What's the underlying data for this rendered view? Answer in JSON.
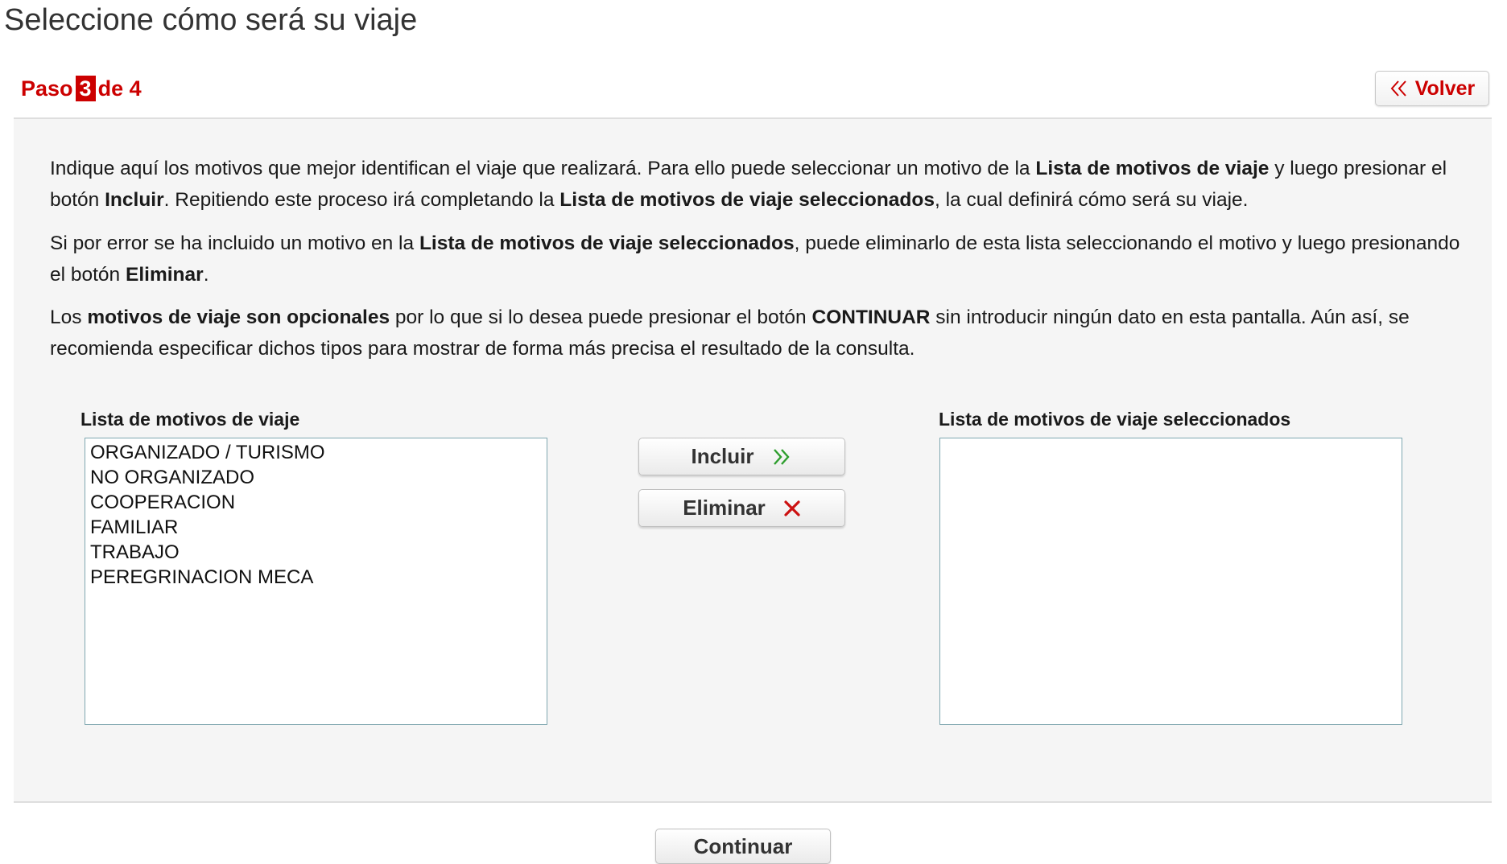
{
  "page": {
    "title": "Seleccione cómo será su viaje"
  },
  "step": {
    "word": "Paso",
    "current": "3",
    "of_text": "de 4"
  },
  "back_button": {
    "label": "Volver",
    "icon": "double-chevron-left-icon",
    "color": "#cc0000"
  },
  "instructions": {
    "p1": {
      "t1": "Indique aquí los motivos que mejor identifican el viaje que realizará. Para ello puede seleccionar un motivo de la ",
      "b1": "Lista de motivos de viaje",
      "t2": " y luego presionar el botón ",
      "b2": "Incluir",
      "t3": ". Repitiendo este proceso irá completando la ",
      "b3": "Lista de motivos de viaje seleccionados",
      "t4": ", la cual definirá cómo será su viaje."
    },
    "p2": {
      "t1": "Si por error se ha incluido un motivo en la ",
      "b1": "Lista de motivos de viaje seleccionados",
      "t2": ", puede eliminarlo de esta lista seleccionando el motivo y luego presionando el botón ",
      "b2": "Eliminar",
      "t3": "."
    },
    "p3": {
      "t1": "Los ",
      "b1": "motivos de viaje son opcionales",
      "t2": " por lo que si lo desea puede presionar el botón ",
      "b2": "CONTINUAR",
      "t3": " sin introducir ningún dato en esta pantalla. Aún así, se recomienda especificar dichos tipos para mostrar de forma más precisa el resultado de la consulta."
    }
  },
  "available_list": {
    "label": "Lista de motivos de viaje",
    "options": [
      "ORGANIZADO / TURISMO",
      "NO ORGANIZADO",
      "COOPERACION",
      "FAMILIAR",
      "TRABAJO",
      "PEREGRINACION MECA"
    ]
  },
  "selected_list": {
    "label": "Lista de motivos de viaje seleccionados",
    "options": []
  },
  "include_button": {
    "label": "Incluir",
    "icon": "double-chevron-right-icon",
    "icon_color": "#2e9e2e"
  },
  "remove_button": {
    "label": "Eliminar",
    "icon": "close-icon",
    "icon_color": "#cc1111"
  },
  "continue_button": {
    "label": "Continuar"
  },
  "colors": {
    "accent": "#cc0000",
    "panel_background": "#f5f5f5",
    "listbox_border": "#7fa7b0"
  }
}
